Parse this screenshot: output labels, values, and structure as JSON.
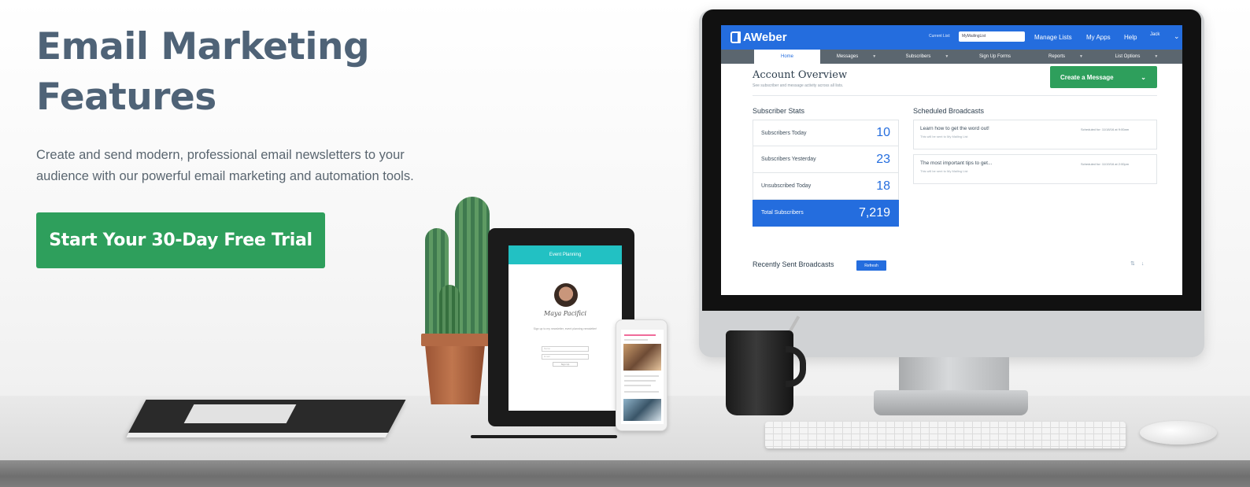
{
  "hero": {
    "title_line1": "Email Marketing",
    "title_line2": "Features",
    "description": "Create and send modern, professional email newsletters to your audience with our powerful email marketing and automation tools.",
    "cta_label": "Start Your 30-Day Free Trial"
  },
  "colors": {
    "title": "#4f6377",
    "cta_green": "#2e9f5c",
    "aweber_blue": "#246dde",
    "tablet_teal": "#22c1c3"
  },
  "aweber": {
    "logo": "AWeber",
    "current_list_label": "Current List:",
    "current_list_value": "MyMailingList",
    "nav": [
      "Manage Lists",
      "My Apps",
      "Help"
    ],
    "user_name": "Jack",
    "tabs": [
      "Home",
      "Messages",
      "Subscribers",
      "Sign Up Forms",
      "Reports",
      "List Options"
    ],
    "account_title": "Account Overview",
    "account_subtitle": "See subscriber and message activity across all lists.",
    "create_button": "Create a Message",
    "subscriber_stats_title": "Subscriber Stats",
    "stats": [
      {
        "label": "Subscribers Today",
        "value": "10"
      },
      {
        "label": "Subscribers Yesterday",
        "value": "23"
      },
      {
        "label": "Unsubscribed Today",
        "value": "18"
      },
      {
        "label": "Total Subscribers",
        "value": "7,219"
      }
    ],
    "scheduled_title": "Scheduled Broadcasts",
    "broadcasts": [
      {
        "title": "Learn how to get the word out!",
        "sub": "This will be sent to My Mailing List",
        "when": "Scheduled for: 11/18/16 at 9:00am"
      },
      {
        "title": "The most important tips to get...",
        "sub": "This will be sent to My Mailing List",
        "when": "Scheduled for: 11/19/16 at 2:00pm"
      }
    ],
    "recent_title": "Recently Sent Broadcasts",
    "refresh_label": "Refresh"
  },
  "tablet": {
    "header": "Event Planning",
    "signature": "Maya Pacifici",
    "text": "Sign up to my newsletter, event planning newsletter!",
    "name_placeholder": "Name",
    "email_placeholder": "Email",
    "button": "Sign Up"
  }
}
